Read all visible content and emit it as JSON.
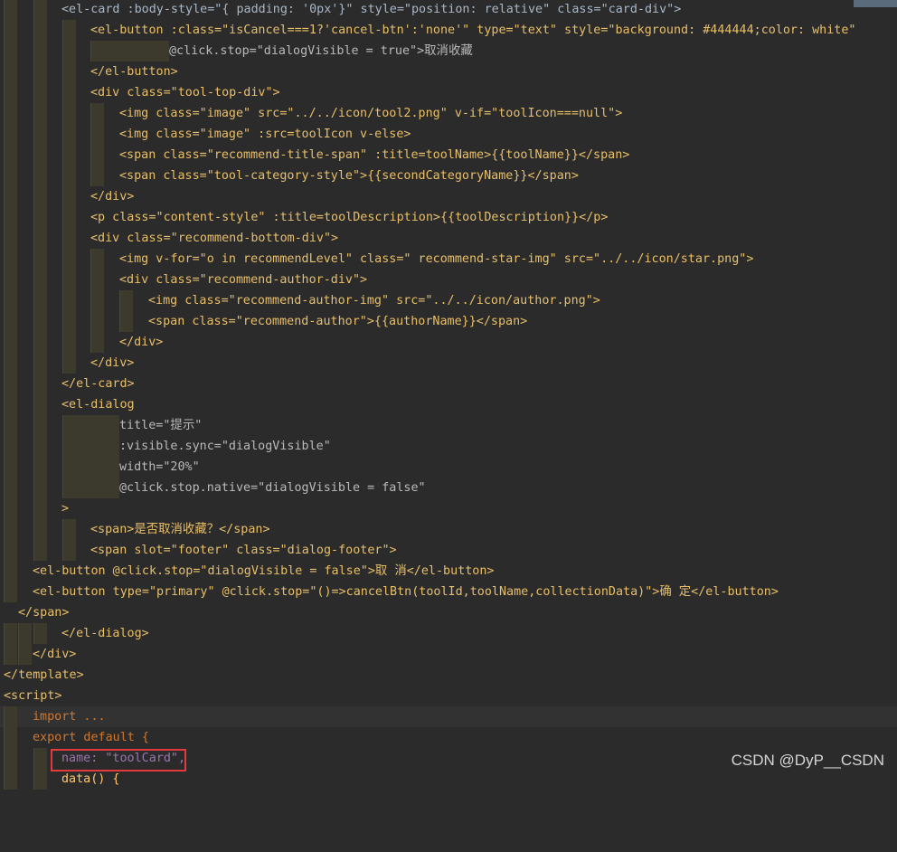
{
  "editor": {
    "lines": [
      "<el-card :body-style=\"{ padding: '0px'}\" style=\"position: relative\" class=\"card-div\">",
      "<el-button :class=\"isCancel===1?'cancel-btn':'none'\" type=\"text\" style=\"background: #444444;color: white\"",
      "@click.stop=\"dialogVisible = true\">取消收藏",
      "</el-button>",
      "<div class=\"tool-top-div\">",
      "<img class=\"image\" src=\"../../icon/tool2.png\" v-if=\"toolIcon===null\">",
      "<img class=\"image\" :src=toolIcon v-else>",
      "<span class=\"recommend-title-span\" :title=toolName>{{toolName}}</span>",
      "<span class=\"tool-category-style\">{{secondCategoryName}}</span>",
      "</div>",
      "<p class=\"content-style\" :title=toolDescription>{{toolDescription}}</p>",
      "<div class=\"recommend-bottom-div\">",
      "<img v-for=\"o in recommendLevel\" class=\" recommend-star-img\" src=\"../../icon/star.png\">",
      "<div class=\"recommend-author-div\">",
      "<img class=\"recommend-author-img\" src=\"../../icon/author.png\">",
      "<span class=\"recommend-author\">{{authorName}}</span>",
      "</div>",
      "</div>",
      "</el-card>",
      "<el-dialog",
      "title=\"提示\"",
      ":visible.sync=\"dialogVisible\"",
      "width=\"20%\"",
      "@click.stop.native=\"dialogVisible = false\"",
      ">",
      "<span>是否取消收藏？</span>",
      "<span slot=\"footer\" class=\"dialog-footer\">",
      "<el-button @click.stop=\"dialogVisible = false\">取 消</el-button>",
      "<el-button type=\"primary\" @click.stop=\"()=>cancelBtn(toolId,toolName,collectionData)\">确 定</el-button>",
      "</span>",
      "</el-dialog>",
      "</div>",
      "</template>",
      "<script>",
      "import ...",
      "export default {",
      "name: \"toolCard\",",
      "data() {"
    ]
  },
  "watermark": "CSDN @DyP__CSDN",
  "colors": {
    "background": "#2b2b2b",
    "tag": "#e8bf6a",
    "attribute": "#bababa",
    "string": "#6a8759",
    "keyword": "#cc7832",
    "highlight_box": "#e23b3b"
  }
}
